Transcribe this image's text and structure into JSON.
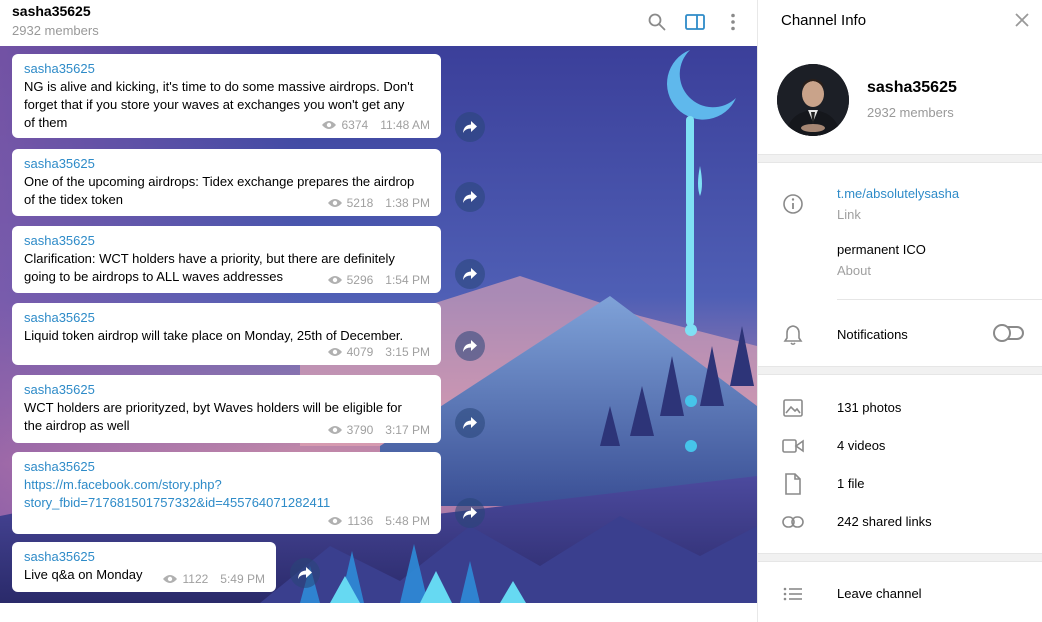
{
  "chat": {
    "title": "sasha35625",
    "subtitle": "2932 members"
  },
  "messages": [
    {
      "author": "sasha35625",
      "lines": [
        "NG is alive and kicking, it's time to do some massive airdrops. Don't",
        "forget that if you store your waves at exchanges you won't get any",
        "of them"
      ],
      "views": "6374",
      "time": "11:48 AM"
    },
    {
      "author": "sasha35625",
      "lines": [
        "One of the upcoming airdrops: Tidex exchange prepares the airdrop",
        "of the tidex token"
      ],
      "views": "5218",
      "time": "1:38 PM"
    },
    {
      "author": "sasha35625",
      "lines": [
        "Clarification: WCT holders have a priority, but there are definitely",
        "going to be airdrops to ALL waves addresses"
      ],
      "views": "5296",
      "time": "1:54 PM"
    },
    {
      "author": "sasha35625",
      "lines": [
        "Liquid token airdrop will take place on Monday, 25th of December."
      ],
      "views": "4079",
      "time": "3:15 PM"
    },
    {
      "author": "sasha35625",
      "lines": [
        "WCT holders are priorityzed, byt Waves holders will be eligible for",
        "the airdrop as well"
      ],
      "views": "3790",
      "time": "3:17 PM"
    },
    {
      "author": "sasha35625",
      "lines": [
        "https://m.facebook.com/story.php?",
        "story_fbid=717681501757332&id=455764071282411"
      ],
      "views": "1136",
      "time": "5:48 PM"
    },
    {
      "author": "sasha35625",
      "lines": [
        "Live q&a on Monday"
      ],
      "views": "1122",
      "time": "5:49 PM"
    }
  ],
  "panel": {
    "title": "Channel Info",
    "name": "sasha35625",
    "members": "2932 members",
    "link": "t.me/absolutelysasha",
    "link_label": "Link",
    "about": "permanent ICO",
    "about_label": "About",
    "notifications_label": "Notifications",
    "notifications_on": false,
    "media": {
      "photos": "131 photos",
      "videos": "4 videos",
      "files": "1 file",
      "links": "242 shared links"
    },
    "leave": "Leave channel"
  },
  "icons": {
    "search": "search-icon",
    "sidebar": "sidebar-toggle-icon",
    "more": "more-vertical-icon",
    "close": "close-icon",
    "info": "info-icon",
    "bell": "bell-icon",
    "photo": "photo-icon",
    "video": "video-icon",
    "file": "file-icon",
    "link": "link-icon",
    "list": "list-icon",
    "share": "share-icon",
    "views": "eye-icon"
  },
  "colors": {
    "accent": "#2e8bc8",
    "muted": "#999999",
    "header_active_icon": "#2e8bc8"
  }
}
